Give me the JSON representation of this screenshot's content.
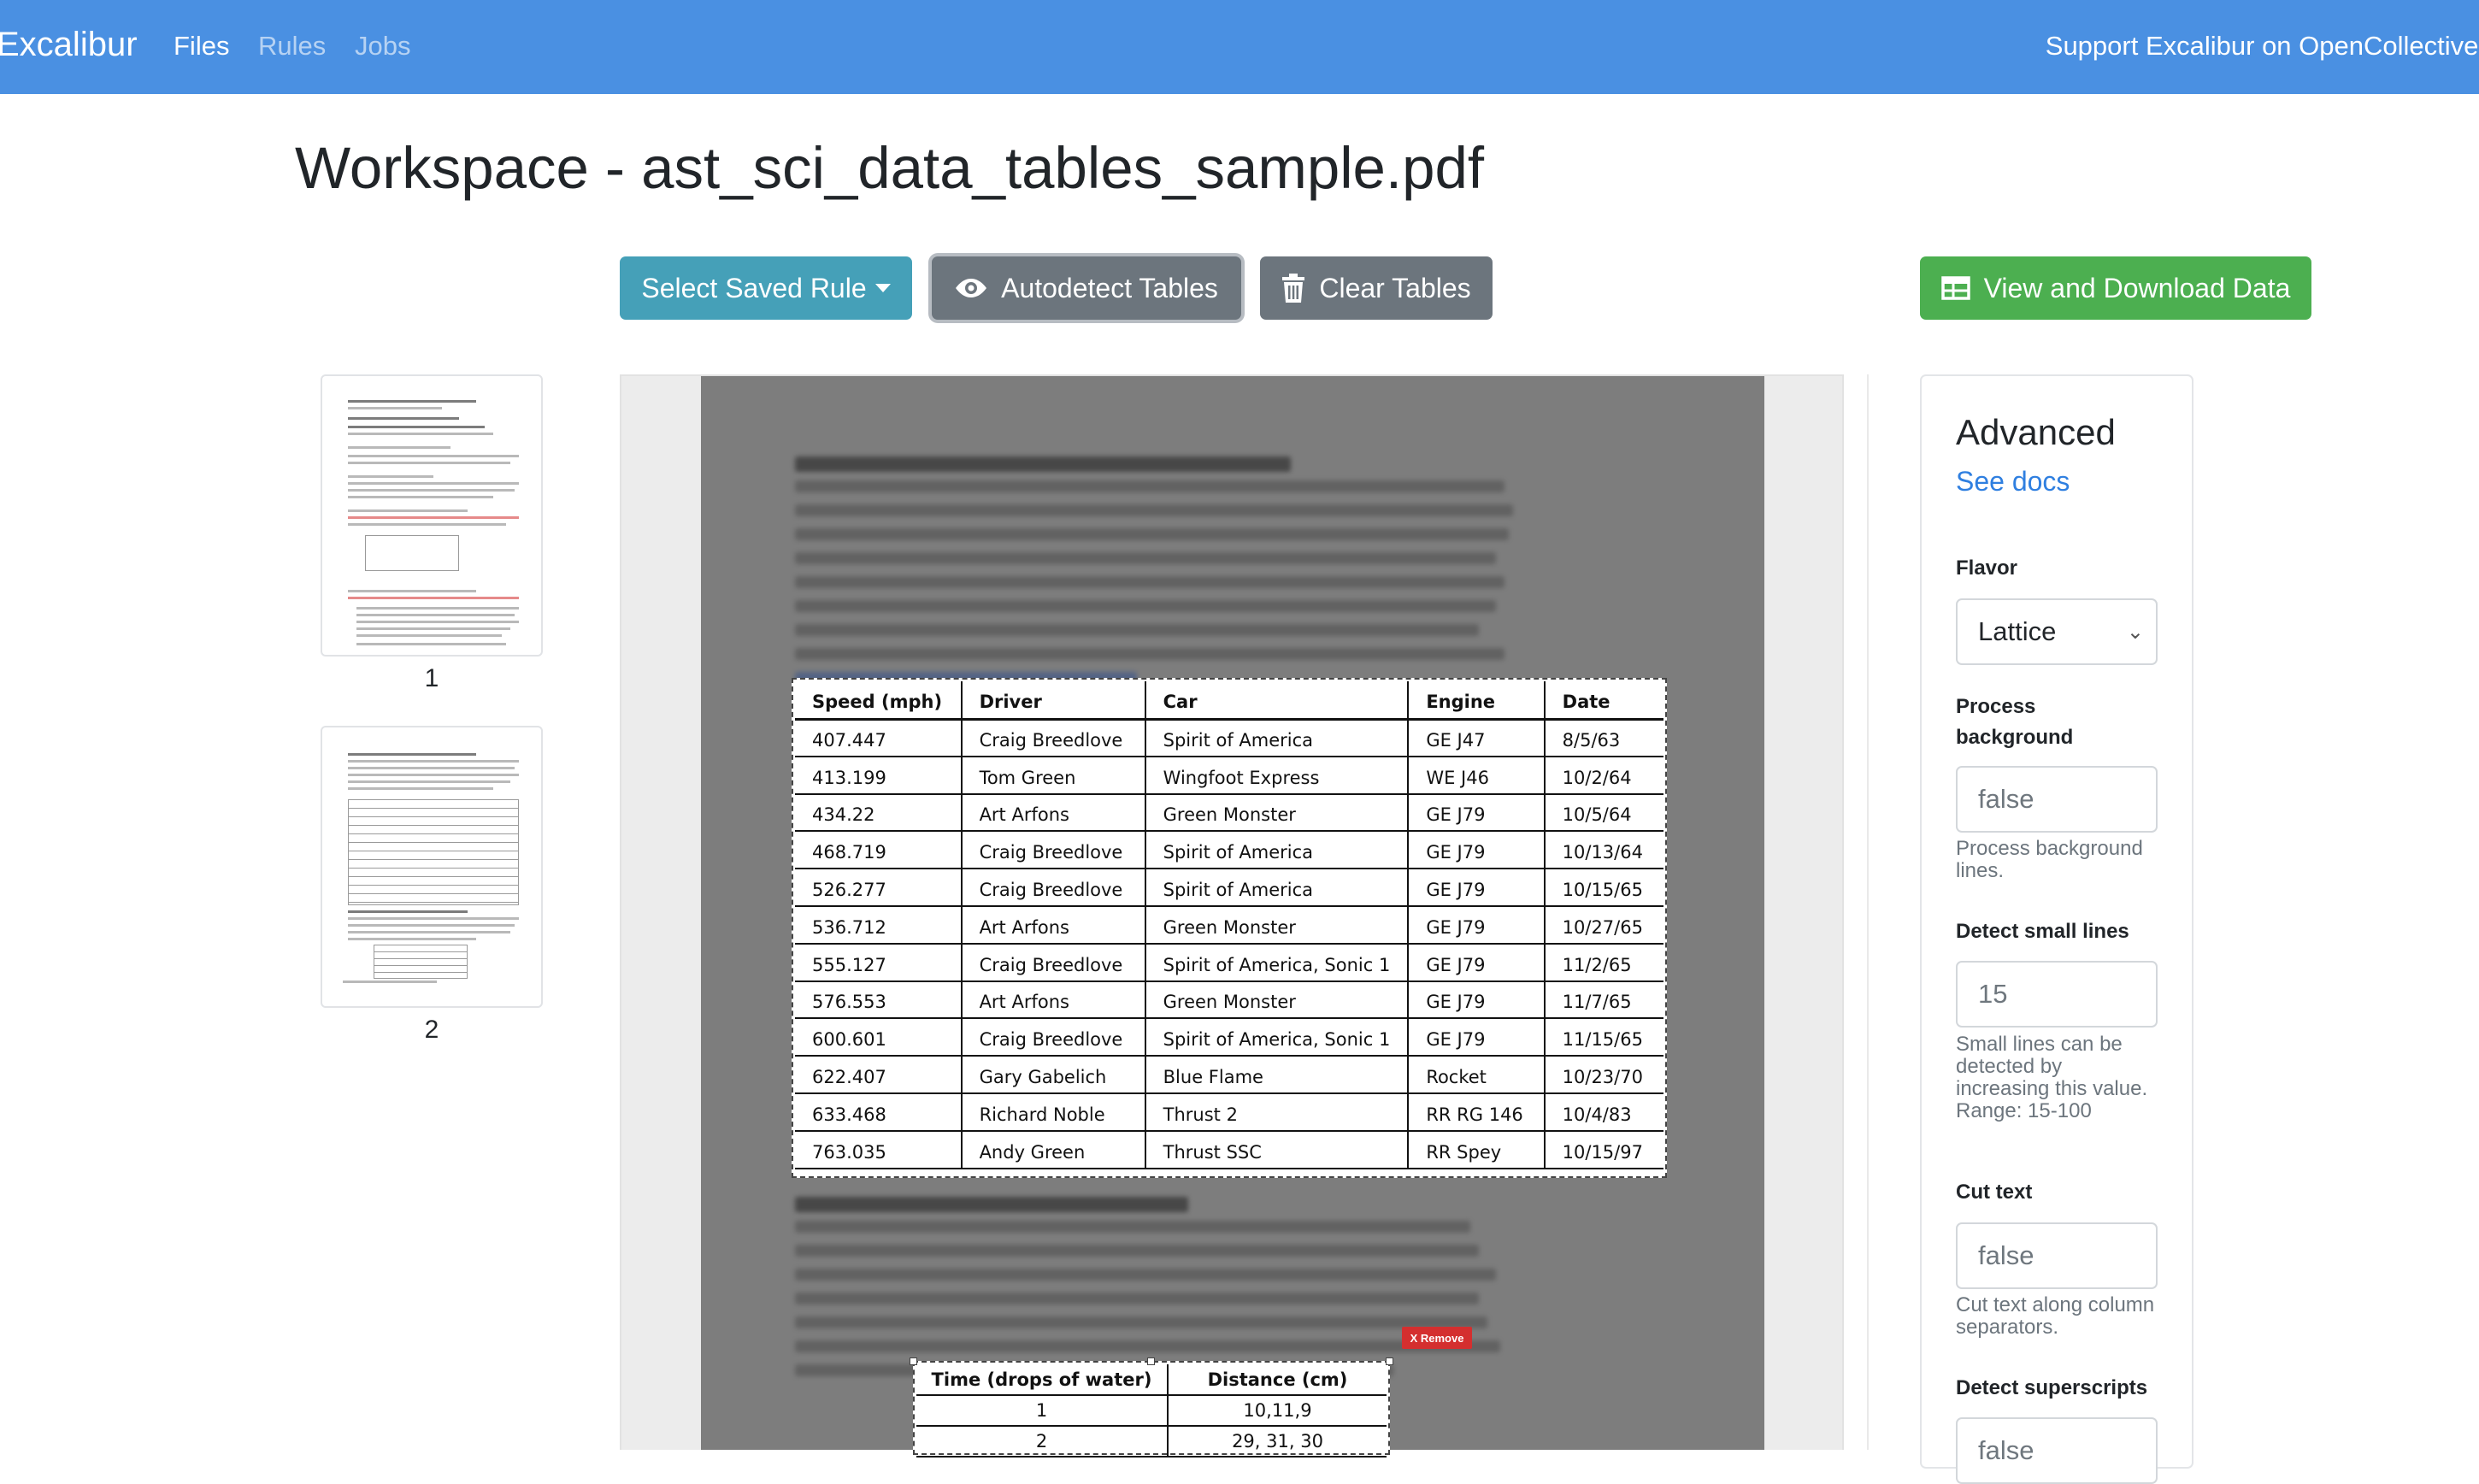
{
  "navbar": {
    "brand": "Excalibur",
    "links": [
      "Files",
      "Rules",
      "Jobs"
    ],
    "support": "Support Excalibur on OpenCollective!"
  },
  "page": {
    "title": "Workspace - ast_sci_data_tables_sample.pdf"
  },
  "toolbar": {
    "select_rule": "Select Saved Rule",
    "autodetect": "Autodetect Tables",
    "clear": "Clear Tables",
    "download": "View and Download Data"
  },
  "thumbnails": [
    {
      "page": "1"
    },
    {
      "page": "2"
    }
  ],
  "table1": {
    "headers": [
      "Speed (mph)",
      "Driver",
      "Car",
      "Engine",
      "Date"
    ],
    "rows": [
      [
        "407.447",
        "Craig Breedlove",
        "Spirit of America",
        "GE J47",
        "8/5/63"
      ],
      [
        "413.199",
        "Tom Green",
        "Wingfoot Express",
        "WE J46",
        "10/2/64"
      ],
      [
        "434.22",
        "Art Arfons",
        "Green Monster",
        "GE J79",
        "10/5/64"
      ],
      [
        "468.719",
        "Craig Breedlove",
        "Spirit of America",
        "GE J79",
        "10/13/64"
      ],
      [
        "526.277",
        "Craig Breedlove",
        "Spirit of America",
        "GE J79",
        "10/15/65"
      ],
      [
        "536.712",
        "Art Arfons",
        "Green Monster",
        "GE J79",
        "10/27/65"
      ],
      [
        "555.127",
        "Craig Breedlove",
        "Spirit of America, Sonic 1",
        "GE J79",
        "11/2/65"
      ],
      [
        "576.553",
        "Art Arfons",
        "Green Monster",
        "GE J79",
        "11/7/65"
      ],
      [
        "600.601",
        "Craig Breedlove",
        "Spirit of America, Sonic 1",
        "GE J79",
        "11/15/65"
      ],
      [
        "622.407",
        "Gary Gabelich",
        "Blue Flame",
        "Rocket",
        "10/23/70"
      ],
      [
        "633.468",
        "Richard Noble",
        "Thrust 2",
        "RR RG 146",
        "10/4/83"
      ],
      [
        "763.035",
        "Andy Green",
        "Thrust SSC",
        "RR Spey",
        "10/15/97"
      ]
    ]
  },
  "table2": {
    "remove_label": "X Remove",
    "headers": [
      "Time (drops of water)",
      "Distance (cm)"
    ],
    "rows": [
      [
        "1",
        "10,11,9"
      ],
      [
        "2",
        "29, 31, 30"
      ]
    ]
  },
  "advanced": {
    "title": "Advanced",
    "docs_link": "See docs",
    "flavor_label": "Flavor",
    "flavor_value": "Lattice",
    "process_background_label": "Process background",
    "process_background_placeholder": "false",
    "process_background_help": "Process background lines.",
    "line_scale_label": "Detect small lines",
    "line_scale_placeholder": "15",
    "line_scale_help": "Small lines can be detected by increasing this value. Range: 15-100",
    "cut_text_label": "Cut text",
    "cut_text_placeholder": "false",
    "cut_text_help": "Cut text along column separators.",
    "superscripts_label": "Detect superscripts",
    "superscripts_placeholder": "false"
  },
  "colors": {
    "navbar": "#4a90e2",
    "info": "#45a0b8",
    "secondary": "#6c757d",
    "success": "#4caf50",
    "danger": "#d42f2f",
    "link": "#2f7fe0"
  }
}
